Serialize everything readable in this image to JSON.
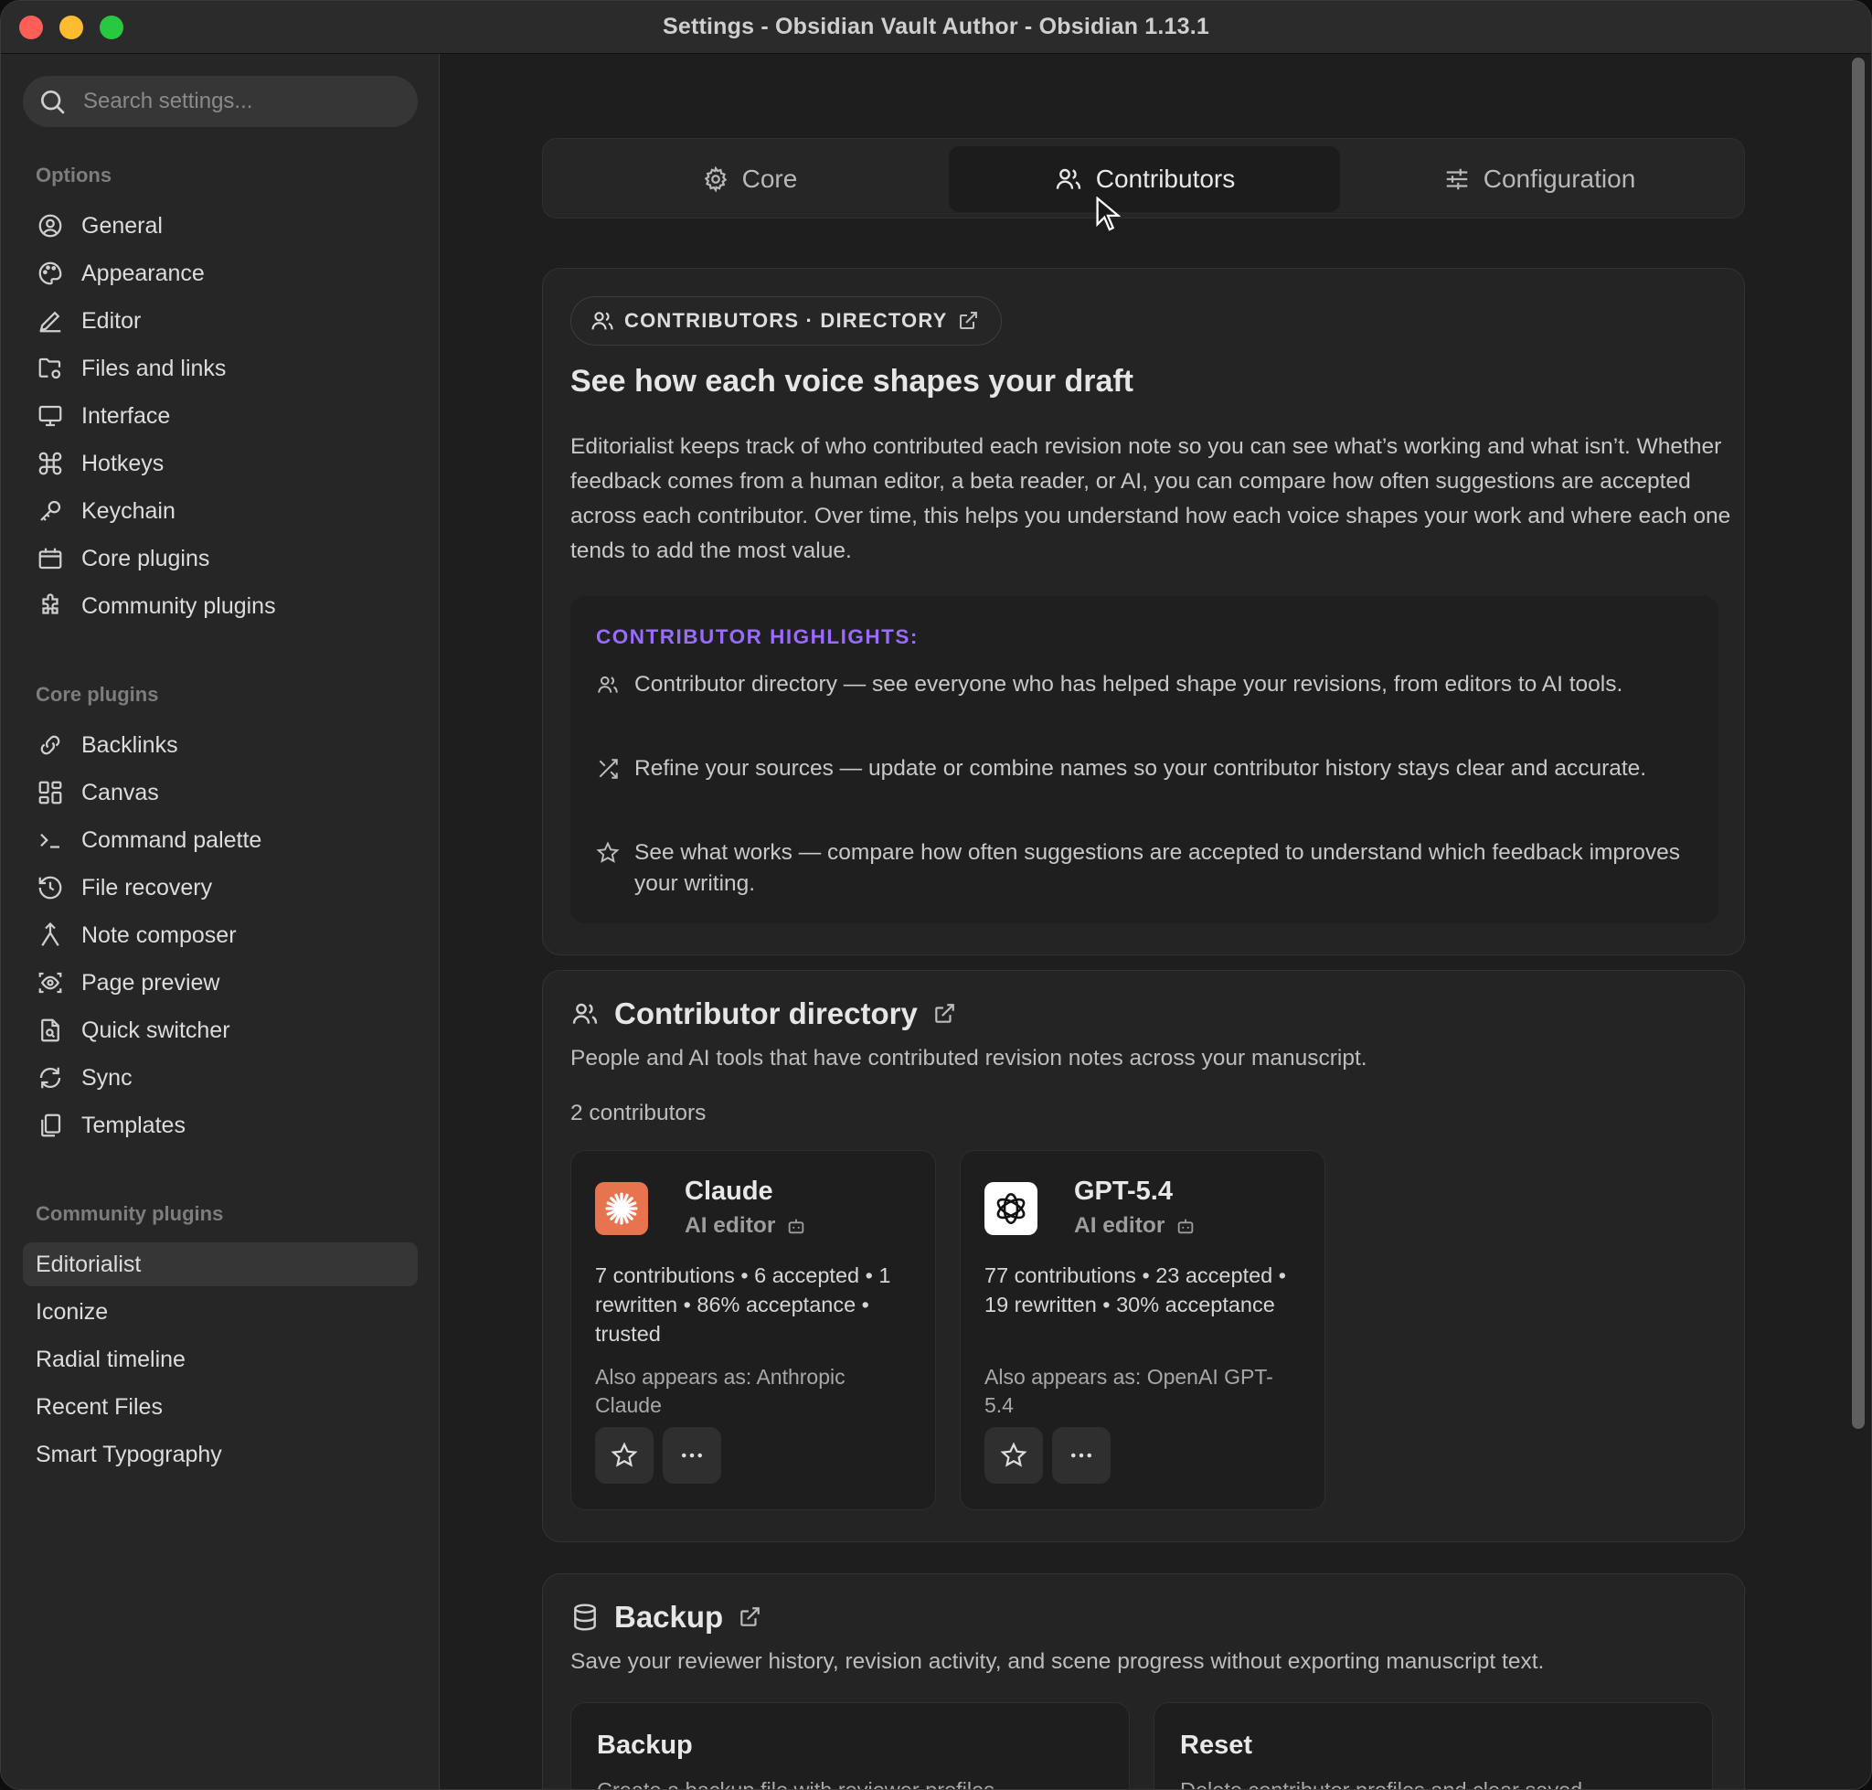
{
  "window": {
    "title": "Settings - Obsidian Vault Author - Obsidian 1.13.1"
  },
  "sidebar": {
    "search_placeholder": "Search settings...",
    "options_heading": "Options",
    "options": [
      {
        "label": "General",
        "icon": "user-circle-icon"
      },
      {
        "label": "Appearance",
        "icon": "palette-icon"
      },
      {
        "label": "Editor",
        "icon": "pencil-icon"
      },
      {
        "label": "Files and links",
        "icon": "folder-cog-icon"
      },
      {
        "label": "Interface",
        "icon": "monitor-icon"
      },
      {
        "label": "Hotkeys",
        "icon": "command-icon"
      },
      {
        "label": "Keychain",
        "icon": "key-icon"
      },
      {
        "label": "Core plugins",
        "icon": "calendar-box-icon"
      },
      {
        "label": "Community plugins",
        "icon": "puzzle-icon"
      }
    ],
    "core_heading": "Core plugins",
    "core": [
      {
        "label": "Backlinks",
        "icon": "backlink-icon"
      },
      {
        "label": "Canvas",
        "icon": "grid-icon"
      },
      {
        "label": "Command palette",
        "icon": "terminal-icon"
      },
      {
        "label": "File recovery",
        "icon": "history-icon"
      },
      {
        "label": "Note composer",
        "icon": "merge-icon"
      },
      {
        "label": "Page preview",
        "icon": "eye-scan-icon"
      },
      {
        "label": "Quick switcher",
        "icon": "file-search-icon"
      },
      {
        "label": "Sync",
        "icon": "sync-icon"
      },
      {
        "label": "Templates",
        "icon": "files-icon"
      }
    ],
    "community_heading": "Community plugins",
    "community": [
      {
        "label": "Editorialist"
      },
      {
        "label": "Iconize"
      },
      {
        "label": "Radial timeline"
      },
      {
        "label": "Recent Files"
      },
      {
        "label": "Smart Typography"
      }
    ]
  },
  "tabs": [
    {
      "label": "Core",
      "icon": "gear-icon"
    },
    {
      "label": "Contributors",
      "icon": "users-icon"
    },
    {
      "label": "Configuration",
      "icon": "sliders-icon"
    }
  ],
  "intro": {
    "pill": "CONTRIBUTORS · DIRECTORY",
    "heading": "See how each voice shapes your draft",
    "body": "Editorialist keeps track of who contributed each revision note so you can see what’s working and what isn’t. Whether feedback comes from a human editor, a beta reader, or AI, you can compare how often suggestions are accepted across each contributor. Over time, this helps you understand how each voice shapes your work and where each one tends to add the most value.",
    "highlights_title": "CONTRIBUTOR HIGHLIGHTS:",
    "highlights": [
      "Contributor directory — see everyone who has helped shape your revisions, from editors to AI tools.",
      "Refine your sources — update or combine names so your contributor history stays clear and accurate.",
      "See what works — compare how often suggestions are accepted to understand which feedback improves your writing."
    ]
  },
  "directory": {
    "title": "Contributor directory",
    "subtitle": "People and AI tools that have contributed revision notes across your manuscript.",
    "count": "2 contributors",
    "contributors": [
      {
        "name": "Claude",
        "role": "AI editor",
        "stats": "7 contributions • 6 accepted • 1 rewritten • 86% acceptance • trusted",
        "alias": "Also appears as: Anthropic Claude",
        "logo_color": "#e7734f"
      },
      {
        "name": "GPT-5.4",
        "role": "AI editor",
        "stats": "77 contributions • 23 accepted • 19 rewritten • 30% acceptance",
        "alias": "Also appears as: OpenAI GPT-5.4",
        "logo_color": "#ffffff"
      }
    ]
  },
  "backup": {
    "title": "Backup",
    "subtitle": "Save your reviewer history, revision activity, and scene progress without exporting manuscript text.",
    "cards": [
      {
        "title": "Backup",
        "desc": "Create a backup file with reviewer profiles"
      },
      {
        "title": "Reset",
        "desc": "Delete contributor profiles and clear saved"
      }
    ]
  }
}
